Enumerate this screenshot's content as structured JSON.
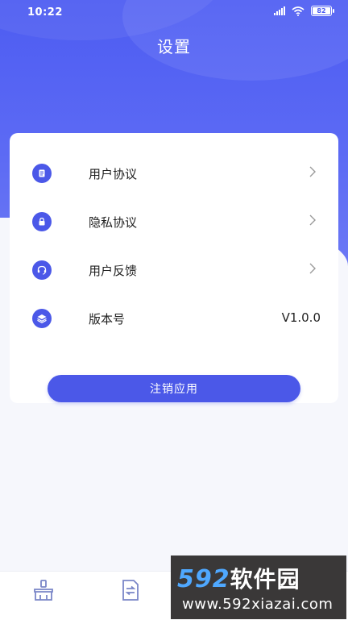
{
  "status_bar": {
    "time": "10:22",
    "battery": "82"
  },
  "header": {
    "title": "设置"
  },
  "menu": {
    "items": [
      {
        "label": "用户协议",
        "icon": "document-icon"
      },
      {
        "label": "隐私协议",
        "icon": "lock-icon"
      },
      {
        "label": "用户反馈",
        "icon": "headset-icon"
      },
      {
        "label": "版本号",
        "icon": "layers-icon",
        "value": "V1.0.0"
      }
    ]
  },
  "actions": {
    "logout_label": "注销应用"
  },
  "tabbar": {
    "tabs": [
      {
        "icon": "brush-icon"
      },
      {
        "icon": "doc-convert-icon"
      }
    ]
  },
  "watermark": {
    "brand_number": "592",
    "brand_text": "软件园",
    "url": "www.592xiazai.com"
  },
  "colors": {
    "accent": "#4b58e8",
    "header_gradient_top": "#4d5cf2",
    "background": "#f6f7fc"
  }
}
